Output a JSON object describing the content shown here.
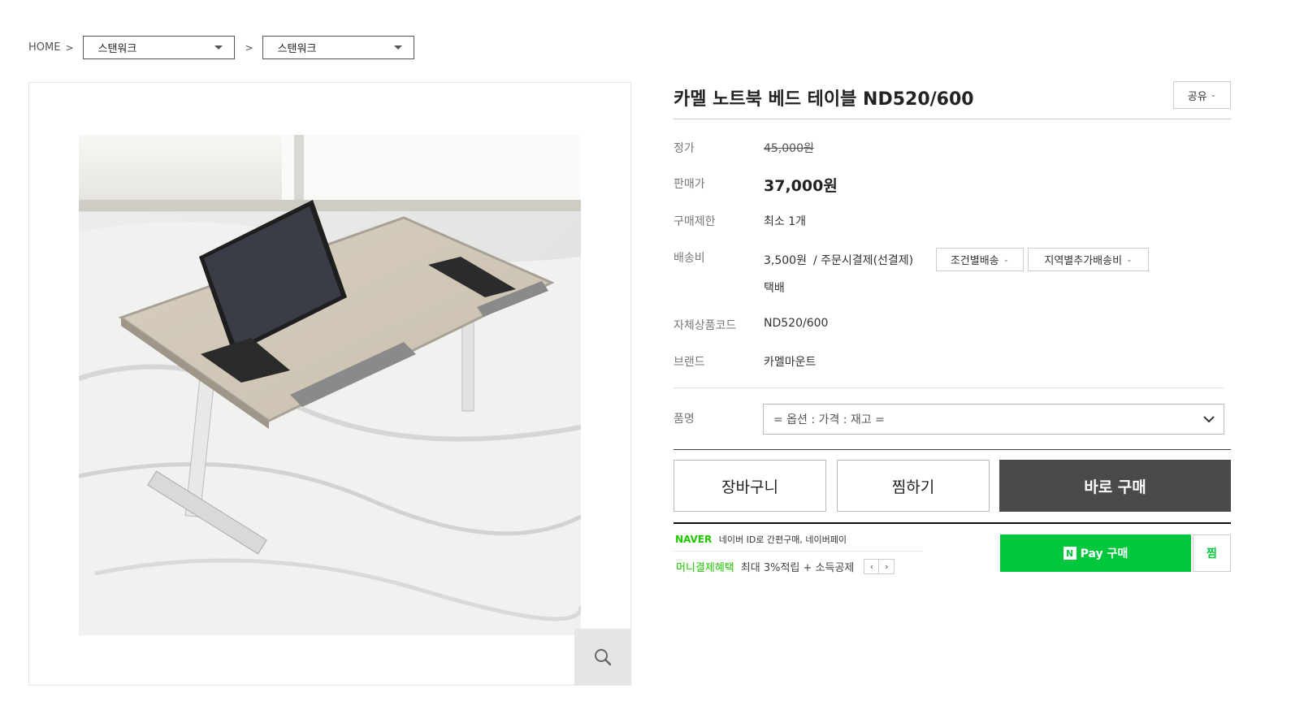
{
  "breadcrumb": {
    "home": "HOME",
    "separator": ">",
    "category1": "스탠워크",
    "category2": "스탠워크"
  },
  "product": {
    "title": "카멜 노트북 베드 테이블 ND520/600",
    "share_label": "공유",
    "image_alt": "노트북 베드 테이블 제품 사진"
  },
  "info": {
    "list_price_label": "정가",
    "list_price": "45,000원",
    "sale_price_label": "판매가",
    "sale_price": "37,000원",
    "purchase_limit_label": "구매제한",
    "purchase_limit": "최소 1개",
    "shipping_label": "배송비",
    "shipping_fee": "3,500원",
    "shipping_method": "/ 주문시결제(선결제)",
    "shipping_cond_button": "조건별배송",
    "shipping_region_button": "지역별추가배송비",
    "shipping_type": "택배",
    "code_label": "자체상품코드",
    "code": "ND520/600",
    "brand_label": "브랜드",
    "brand": "카멜마운트"
  },
  "option": {
    "label": "품명",
    "placeholder": "= 옵션 : 가격 : 재고 ="
  },
  "actions": {
    "cart": "장바구니",
    "wish": "찜하기",
    "buy": "바로 구매"
  },
  "naver": {
    "logo": "NAVER",
    "tagline": "네이버 ID로 간편구매, 네이버페이",
    "benefit_label": "머니결제혜택",
    "benefit_text": "최대 3%적립 + 소득공제",
    "pay_n": "N",
    "pay_label": "Pay 구매",
    "wish_label": "찜"
  },
  "icons": {
    "zoom": "magnifier-icon",
    "select_caret": "chevron-down-icon"
  }
}
